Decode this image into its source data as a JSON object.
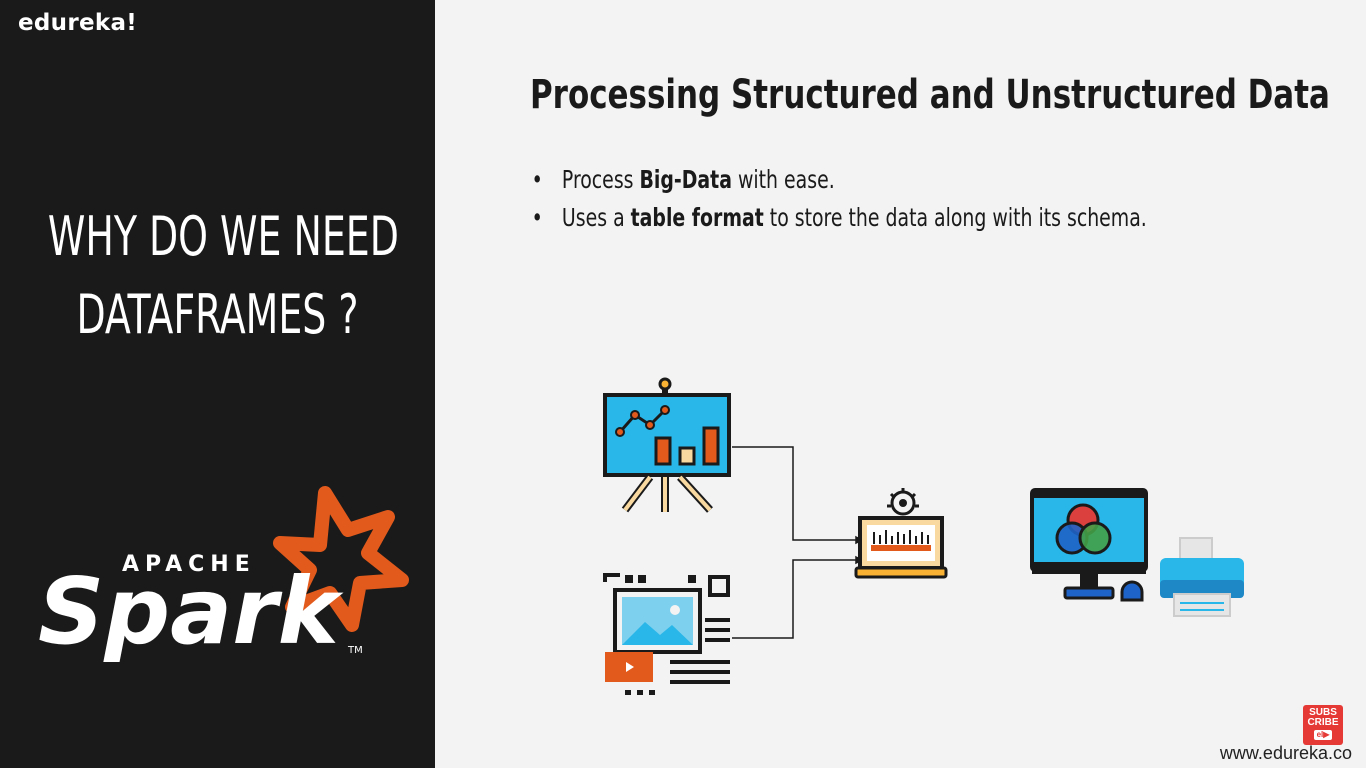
{
  "brand": {
    "name": "edureka!"
  },
  "left": {
    "title_line1": "WHY DO WE NEED",
    "title_line2": "DATAFRAMES ?",
    "logo_text_small": "APACHE",
    "logo_text_big": "Spark",
    "logo_tm": "TM"
  },
  "slide": {
    "title": "Processing Structured and Unstructured Data",
    "bullets": [
      {
        "pre": "Process ",
        "bold": "Big-Data",
        "post": " with ease."
      },
      {
        "pre": "Uses a ",
        "bold": "table format",
        "post": " to store the data along with its schema."
      }
    ]
  },
  "subscribe": {
    "line1": "SUBS",
    "line2": "CRIBE",
    "bell": "el▶"
  },
  "footer": {
    "url": "www.edureka.co"
  },
  "icons": [
    "presentation-board-chart-icon",
    "media-document-icon",
    "laptop-processing-icon",
    "monitor-color-wheel-icon",
    "printer-icon"
  ],
  "colors": {
    "left_bg": "#1a1a1a",
    "right_bg": "#f3f3f3",
    "spark_orange": "#e25a1c",
    "accent_blue": "#29b6e8"
  }
}
